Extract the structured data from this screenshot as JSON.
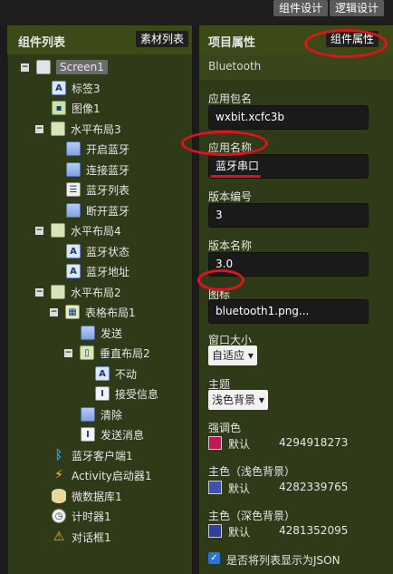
{
  "topbar": {
    "designer": "组件设计",
    "blocks": "逻辑设计"
  },
  "left_panel": {
    "title": "组件列表",
    "button": "素材列表",
    "tree": [
      {
        "label": "Screen1",
        "icon": "screen-icon",
        "toggle": "−"
      },
      {
        "label": "标签3",
        "icon": "label-icon"
      },
      {
        "label": "图像1",
        "icon": "image-icon"
      },
      {
        "label": "水平布局3",
        "icon": "horizontal-arrangement-icon",
        "toggle": "−"
      },
      {
        "label": "开启蓝牙",
        "icon": "button-icon"
      },
      {
        "label": "连接蓝牙",
        "icon": "button-icon"
      },
      {
        "label": "蓝牙列表",
        "icon": "listpicker-icon"
      },
      {
        "label": "断开蓝牙",
        "icon": "button-icon"
      },
      {
        "label": "水平布局4",
        "icon": "horizontal-arrangement-icon",
        "toggle": "−"
      },
      {
        "label": "蓝牙状态",
        "icon": "label-icon"
      },
      {
        "label": "蓝牙地址",
        "icon": "label-icon"
      },
      {
        "label": "水平布局2",
        "icon": "horizontal-arrangement-icon",
        "toggle": "−"
      },
      {
        "label": "表格布局1",
        "icon": "table-arrangement-icon",
        "toggle": "−"
      },
      {
        "label": "发送",
        "icon": "button-icon"
      },
      {
        "label": "垂直布局2",
        "icon": "vertical-arrangement-icon",
        "toggle": "−"
      },
      {
        "label": "不动",
        "icon": "label-icon"
      },
      {
        "label": "接受信息",
        "icon": "textbox-icon"
      },
      {
        "label": "清除",
        "icon": "button-icon"
      },
      {
        "label": "发送消息",
        "icon": "textbox-icon"
      },
      {
        "label": "蓝牙客户端1",
        "icon": "bluetooth-icon"
      },
      {
        "label": "Activity启动器1",
        "icon": "activity-starter-icon"
      },
      {
        "label": "微数据库1",
        "icon": "database-icon"
      },
      {
        "label": "计时器1",
        "icon": "clock-icon"
      },
      {
        "label": "对话框1",
        "icon": "notifier-icon"
      }
    ]
  },
  "right_panel": {
    "title": "项目属性",
    "button": "组件属性",
    "component": "Bluetooth",
    "props": {
      "package_label": "应用包名",
      "package_value": "wxbit.xcfc3b",
      "appname_label": "应用名称",
      "appname_value": "蓝牙串口",
      "vcode_label": "版本编号",
      "vcode_value": "3",
      "vname_label": "版本名称",
      "vname_value": "3.0",
      "icon_label": "图标",
      "icon_value": "bluetooth1.png...",
      "size_label": "窗口大小",
      "size_value": "自适应 ▾",
      "theme_label": "主题",
      "theme_value": "浅色背景 ▾",
      "accent_label": "强调色",
      "accent_text": "默认",
      "accent_num": "4294918273",
      "primary_label": "主色（浅色背景）",
      "primary_text": "默认",
      "primary_num": "4282339765",
      "primary_dark_label": "主色（深色背景）",
      "primary_dark_text": "默认",
      "primary_dark_num": "4281352095",
      "json_label": "是否将列表显示为JSON"
    },
    "colors": {
      "accent": "#c2185b",
      "primary": "#3f51b5",
      "primary_dark": "#303f9f",
      "annotation": "#e0121b"
    }
  }
}
